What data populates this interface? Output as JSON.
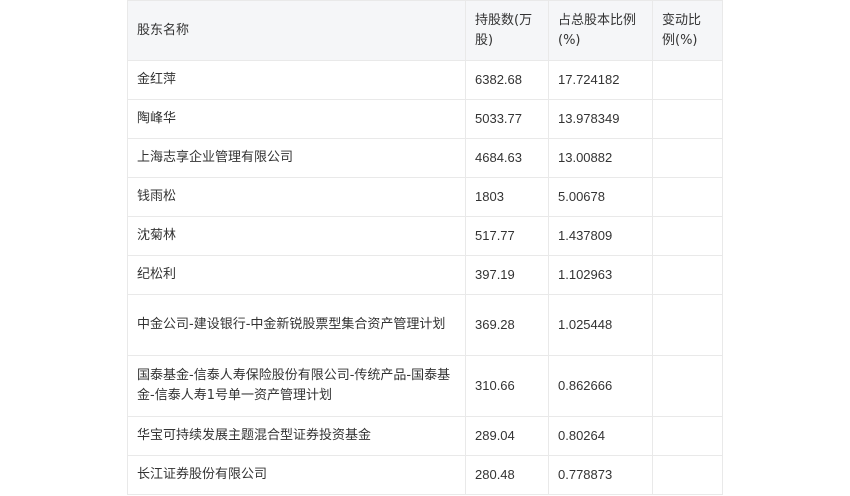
{
  "table": {
    "headers": [
      "股东名称",
      "持股数(万股)",
      "占总股本比例(%)",
      "变动比例(%)"
    ],
    "rows": [
      {
        "name": "金红萍",
        "shares": "6382.68",
        "ratio": "17.724182",
        "change": ""
      },
      {
        "name": "陶峰华",
        "shares": "5033.77",
        "ratio": "13.978349",
        "change": ""
      },
      {
        "name": "上海志享企业管理有限公司",
        "shares": "4684.63",
        "ratio": "13.00882",
        "change": ""
      },
      {
        "name": "钱雨松",
        "shares": "1803",
        "ratio": "5.00678",
        "change": ""
      },
      {
        "name": "沈菊林",
        "shares": "517.77",
        "ratio": "1.437809",
        "change": ""
      },
      {
        "name": "纪松利",
        "shares": "397.19",
        "ratio": "1.102963",
        "change": ""
      },
      {
        "name": "中金公司-建设银行-中金新锐股票型集合资产管理计划",
        "shares": "369.28",
        "ratio": "1.025448",
        "change": ""
      },
      {
        "name": "国泰基金-信泰人寿保险股份有限公司-传统产品-国泰基金-信泰人寿1号单一资产管理计划",
        "shares": "310.66",
        "ratio": "0.862666",
        "change": ""
      },
      {
        "name": "华宝可持续发展主题混合型证券投资基金",
        "shares": "289.04",
        "ratio": "0.80264",
        "change": ""
      },
      {
        "name": "长江证券股份有限公司",
        "shares": "280.48",
        "ratio": "0.778873",
        "change": ""
      }
    ]
  }
}
